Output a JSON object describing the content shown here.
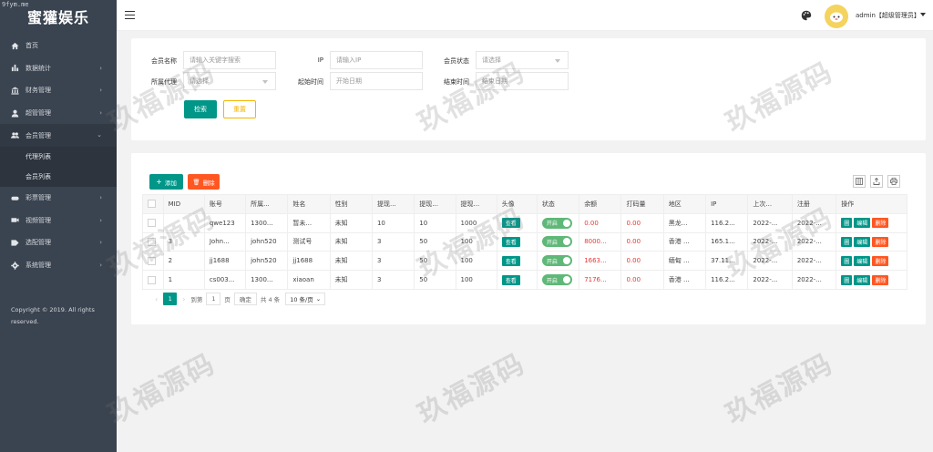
{
  "watermark_url": "9fym.me",
  "app": {
    "title": "蜜獾娱乐"
  },
  "sidebar": {
    "items": [
      {
        "label": "首页",
        "icon": "home-icon",
        "arrow": ""
      },
      {
        "label": "数据统计",
        "icon": "bar-chart-icon",
        "arrow": "›"
      },
      {
        "label": "财务管理",
        "icon": "bank-icon",
        "arrow": "›"
      },
      {
        "label": "超管管理",
        "icon": "user-icon",
        "arrow": "›"
      },
      {
        "label": "会员管理",
        "icon": "users-icon",
        "arrow": "⌄"
      }
    ],
    "subitems": [
      {
        "label": "代理列表"
      },
      {
        "label": "会员列表"
      }
    ],
    "items_after": [
      {
        "label": "彩票管理",
        "icon": "gamepad-icon",
        "arrow": "›"
      },
      {
        "label": "视频管理",
        "icon": "video-icon",
        "arrow": "›"
      },
      {
        "label": "选配管理",
        "icon": "tag-icon",
        "arrow": "›"
      },
      {
        "label": "系统管理",
        "icon": "gear-icon",
        "arrow": "›"
      }
    ],
    "copyright": "Copyright © 2019. All rights reserved."
  },
  "header": {
    "user": "admin【超级管理员】"
  },
  "search": {
    "member_label": "会员名称",
    "member_placeholder": "请输入关键字搜索",
    "ip_label": "IP",
    "ip_placeholder": "请输入IP",
    "status_label": "会员状态",
    "status_value": "请选择",
    "agent_label": "所属代理",
    "agent_value": "请选择",
    "start_label": "起始时间",
    "start_placeholder": "开始日期",
    "end_label": "结束时间",
    "end_placeholder": "结束日期",
    "search_button": "检索",
    "reset_button": "重置"
  },
  "toolbar": {
    "add_label": "添加",
    "delete_label": "删除"
  },
  "table": {
    "headers": [
      "MID",
      "账号",
      "所属...",
      "姓名",
      "性别",
      "提现...",
      "提现...",
      "提现...",
      "头像",
      "状态",
      "余额",
      "打码量",
      "地区",
      "IP",
      "上次...",
      "注册",
      "操作"
    ],
    "rows": [
      [
        "",
        "qwe123",
        "1300...",
        "暂未...",
        "未知",
        "10",
        "10",
        "1000",
        "查看",
        "开启",
        "0.00",
        "0.00",
        "黑龙...",
        "116.2...",
        "2022-...",
        "2022-..."
      ],
      [
        "3",
        "John...",
        "john520",
        "测试号",
        "未知",
        "3",
        "50",
        "100",
        "查看",
        "开启",
        "8000...",
        "0.00",
        "香港 ...",
        "165.1...",
        "2022-...",
        "2022-..."
      ],
      [
        "2",
        "jj1688",
        "john520",
        "jj1688",
        "未知",
        "3",
        "50",
        "100",
        "查看",
        "开启",
        "1663...",
        "0.00",
        "缅甸 ...",
        "37.11...",
        "2022-...",
        "2022-..."
      ],
      [
        "1",
        "cs003...",
        "1300...",
        "xiaoan",
        "未知",
        "3",
        "50",
        "100",
        "查看",
        "开启",
        "7176...",
        "0.00",
        "香港 ...",
        "116.2...",
        "2022-...",
        "2022-..."
      ]
    ],
    "ops": [
      "圖",
      "编辑",
      "删除"
    ]
  },
  "pager": {
    "prev": "‹",
    "current": "1",
    "next": "›",
    "goto": "到第",
    "page_input": "1",
    "page_unit": "页",
    "confirm": "确定",
    "total": "共 4 条",
    "per_page": "10 条/页"
  },
  "watermark_text": "玖福源码",
  "colors": {
    "sidebar": "#3a4350",
    "primary": "#009688",
    "danger": "#ff5722",
    "warn": "#f5b400",
    "switch_on": "#5fb878",
    "money_red": "#e53935"
  }
}
